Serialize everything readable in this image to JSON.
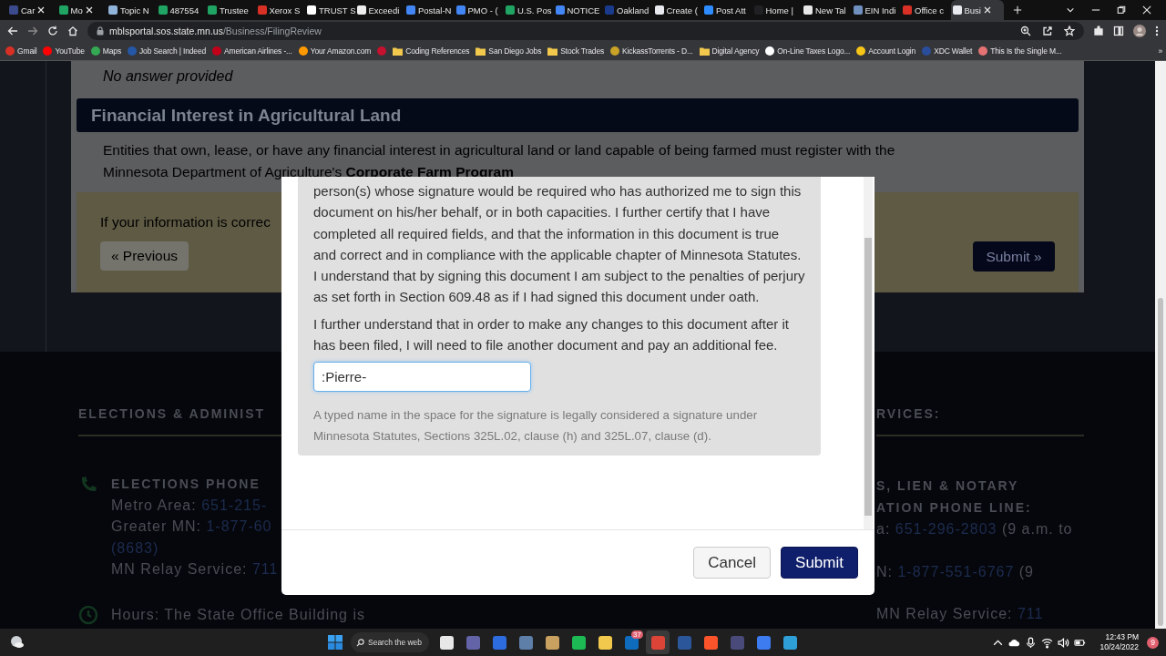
{
  "tabs": [
    {
      "title": "Car",
      "color": "#3b4a8c",
      "closable": true,
      "selected": false
    },
    {
      "title": "Mo",
      "color": "#1fa463",
      "closable": true,
      "selected": false
    },
    {
      "title": "Topic N",
      "color": "#8fb3d9",
      "closable": false,
      "selected": false
    },
    {
      "title": "487554",
      "color": "#1fa463",
      "closable": false,
      "selected": false
    },
    {
      "title": "Trustee",
      "color": "#1fa463",
      "closable": false,
      "selected": false
    },
    {
      "title": "Xerox S",
      "color": "#d93025",
      "closable": false,
      "selected": false
    },
    {
      "title": "TRUST S",
      "color": "#ffffff",
      "closable": false,
      "selected": false
    },
    {
      "title": "Exceedi",
      "color": "#eeeeee",
      "closable": false,
      "selected": false
    },
    {
      "title": "Postal-N",
      "color": "#4285f4",
      "closable": false,
      "selected": false
    },
    {
      "title": "PMO - (",
      "color": "#4285f4",
      "closable": false,
      "selected": false
    },
    {
      "title": "U.S. Pos",
      "color": "#1fa463",
      "closable": false,
      "selected": false
    },
    {
      "title": "NOTICE",
      "color": "#4285f4",
      "closable": false,
      "selected": false
    },
    {
      "title": "Oakland",
      "color": "#1a3a8c",
      "closable": false,
      "selected": false
    },
    {
      "title": "Create (",
      "color": "#e8eaf0",
      "closable": false,
      "selected": false
    },
    {
      "title": "Post Att",
      "color": "#2d8cff",
      "closable": false,
      "selected": false
    },
    {
      "title": "Home |",
      "color": "#202124",
      "closable": false,
      "selected": false
    },
    {
      "title": "New Tal",
      "color": "#e8e8e8",
      "closable": false,
      "selected": false
    },
    {
      "title": "EIN Indi",
      "color": "#6f8fbf",
      "closable": false,
      "selected": false
    },
    {
      "title": "Office c",
      "color": "#d93025",
      "closable": false,
      "selected": false
    },
    {
      "title": "Busi",
      "color": "#e8eaf0",
      "closable": true,
      "selected": true
    }
  ],
  "address": {
    "host": "mblsportal.sos.state.mn.us",
    "path": "/Business/FilingReview"
  },
  "bookmarks": [
    {
      "label": "Gmail",
      "color": "#d93025",
      "kind": "site"
    },
    {
      "label": "YouTube",
      "color": "#ff0000",
      "kind": "site"
    },
    {
      "label": "Maps",
      "color": "#34a853",
      "kind": "site"
    },
    {
      "label": "Job Search | Indeed",
      "color": "#2557a7",
      "kind": "site"
    },
    {
      "label": "American Airlines -...",
      "color": "#c30019",
      "kind": "site"
    },
    {
      "label": "Your Amazon.com",
      "color": "#ff9900",
      "kind": "site"
    },
    {
      "color": "#c4122f",
      "kind": "site"
    },
    {
      "label": "Coding References",
      "color": "#f2c94c",
      "kind": "folder"
    },
    {
      "label": "San Diego Jobs",
      "color": "#f2c94c",
      "kind": "folder"
    },
    {
      "label": "Stock Trades",
      "color": "#f2c94c",
      "kind": "folder"
    },
    {
      "label": "KickassTorrents - D...",
      "color": "#c9a227",
      "kind": "site"
    },
    {
      "label": "Digital Agency",
      "color": "#f2c94c",
      "kind": "folder"
    },
    {
      "label": "On-Line Taxes Logo...",
      "color": "#ffffff",
      "kind": "site"
    },
    {
      "label": "Account Login",
      "color": "#f5c518",
      "kind": "site"
    },
    {
      "label": "XDC Wallet",
      "color": "#2a4d9b",
      "kind": "site"
    },
    {
      "label": "This Is the Single M...",
      "color": "#e57373",
      "kind": "site"
    }
  ],
  "bookmarks_more": "»",
  "page": {
    "answer": "No answer provided",
    "section_title": "Financial Interest in Agricultural Land",
    "paragraph": {
      "text": "Entities that own, lease, or have any financial interest in agricultural land or land capable of being farmed must register with the Minnesota Department of Agriculture's",
      "link": "Corporate Farm Program"
    },
    "confirm_text": "If your information is correc",
    "previous_button": "« Previous",
    "submit_button": "Submit »"
  },
  "footer": {
    "left": {
      "heading": "ELECTIONS & ADMINIST",
      "title_lines": [
        "ELECTIONS PHONE"
      ],
      "lines": [
        {
          "label": "Metro Area:",
          "link": "651-215-"
        },
        {
          "label": "Greater MN:",
          "link": "1-877-60"
        },
        {
          "link": "(8683)"
        },
        {
          "label": "MN Relay Service:",
          "link": "711"
        }
      ],
      "hours": "Hours: The State Office Building is"
    },
    "right": {
      "heading": "RVICES:",
      "title_lines": [
        "S, LIEN & NOTARY",
        "ATION PHONE LINE:"
      ],
      "lines": [
        {
          "label": "a:",
          "link": "651-296-2803",
          "note": "(9 a.m. to"
        },
        {
          "label": "N:",
          "link": "1-877-551-6767",
          "note": "(9"
        },
        {
          "label": "MN Relay Service:",
          "link": "711"
        }
      ]
    }
  },
  "modal": {
    "paragraphs": [
      "person(s) whose signature would be required who has authorized me to sign this document on his/her behalf, or in both capacities. I further certify that I have completed all required fields, and that the information in this document is true and correct and in compliance with the applicable chapter of Minnesota Statutes. I understand that by signing this document I am subject to the penalties of perjury as set forth in Section 609.48 as if I had signed this document under oath.",
      "I further understand that in order to make any changes to this document after it has been filed, I will need to file another document and pay an additional fee."
    ],
    "signature": {
      "value": ":Pierre-"
    },
    "note": "A typed name in the space for the signature is legally considered a signature under Minnesota Statutes, Sections 325L.02, clause (h) and 325L.07, clause (d).",
    "buttons": [
      {
        "label": "Cancel",
        "kind": "secondary"
      },
      {
        "label": "Submit",
        "kind": "primary"
      }
    ]
  },
  "taskbar": {
    "search": "Search the web",
    "apps": [
      {
        "color": "#e8e8e8",
        "selected": false
      },
      {
        "color": "#6264a7",
        "selected": false
      },
      {
        "color": "#2d6cdf",
        "selected": false
      },
      {
        "color": "#5d7fa8",
        "selected": false
      },
      {
        "color": "#c8a060",
        "selected": false
      },
      {
        "color": "#1db954",
        "selected": false
      },
      {
        "color": "#f2c94c",
        "selected": false
      },
      {
        "color": "#0f6cbd",
        "selected": false,
        "badge": "37"
      },
      {
        "color": "#db4437",
        "selected": true
      },
      {
        "color": "#2b579a",
        "selected": false
      },
      {
        "color": "#fb542b",
        "selected": false
      },
      {
        "color": "#4a4a7a",
        "selected": false
      },
      {
        "color": "#3d7bf0",
        "selected": false
      },
      {
        "color": "#2f9fd8",
        "selected": false
      }
    ],
    "time": "12:43 PM",
    "date": "10/24/2022",
    "notifications": "9"
  }
}
